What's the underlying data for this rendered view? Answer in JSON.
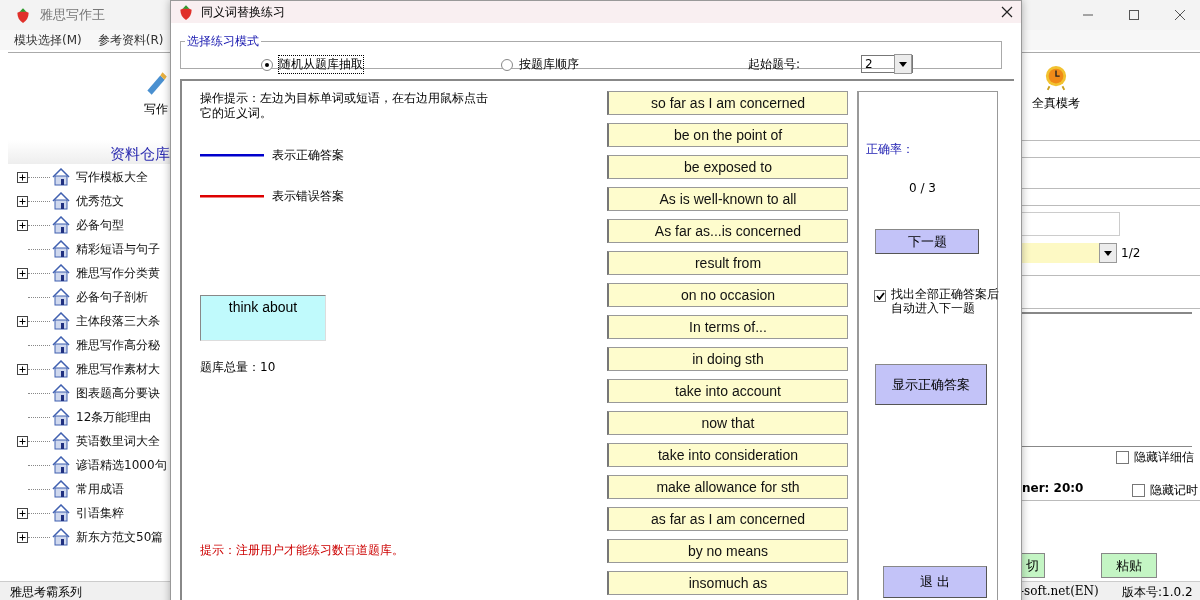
{
  "main_window": {
    "title": "雅思写作王",
    "menu": [
      "模块选择(M)",
      "参考资料(R)"
    ],
    "toolbar": [
      "写作",
      "全真模考"
    ],
    "library": {
      "title": "资料仓库",
      "items": [
        {
          "label": "写作模板大全",
          "expandable": true
        },
        {
          "label": "优秀范文",
          "expandable": true
        },
        {
          "label": "必备句型",
          "expandable": true
        },
        {
          "label": "精彩短语与句子",
          "expandable": false
        },
        {
          "label": "雅思写作分类黄",
          "expandable": true
        },
        {
          "label": "必备句子剖析",
          "expandable": false
        },
        {
          "label": "主体段落三大杀",
          "expandable": true
        },
        {
          "label": "雅思写作高分秘",
          "expandable": false
        },
        {
          "label": "雅思写作素材大",
          "expandable": true
        },
        {
          "label": "图表题高分要诀",
          "expandable": false
        },
        {
          "label": "12条万能理由",
          "expandable": false
        },
        {
          "label": "英语数里词大全",
          "expandable": true
        },
        {
          "label": "谚语精选1000句",
          "expandable": false
        },
        {
          "label": "常用成语",
          "expandable": false
        },
        {
          "label": "引语集粹",
          "expandable": true
        },
        {
          "label": "新东方范文50篇",
          "expandable": true
        }
      ]
    },
    "page_indicator": "1/2",
    "options": [
      {
        "label": "隐藏详细信",
        "checked": false
      },
      {
        "label": "隐藏记时",
        "checked": false
      }
    ],
    "timer": "ner: 20:0",
    "buttons": [
      "切",
      "粘贴"
    ],
    "status_bar": [
      "雅思考霸系列",
      "-soft.net(EN)",
      "版本号:1.0.2"
    ]
  },
  "dialog": {
    "title": "同义词替换练习",
    "mode_group": {
      "title": "选择练习模式",
      "options": [
        {
          "label": "随机从题库抽取",
          "selected": true
        },
        {
          "label": "按题库顺序",
          "selected": false
        }
      ],
      "start_label": "起始题号:",
      "start_value": "2"
    },
    "instructions": "操作提示：左边为目标单词或短语，在右边用鼠标点击它的近义词。",
    "legend": [
      {
        "label": "表示正确答案",
        "color": "#0000cc"
      },
      {
        "label": "表示错误答案",
        "color": "#dd0000"
      }
    ],
    "target": "think about",
    "bank_total": "题库总量：10",
    "notice": "提示：注册用户才能练习数百道题库。",
    "choices": [
      "so far as I am concerned",
      "be on the point of",
      "be exposed to",
      "As is well-known to all",
      "As far as...is concerned",
      "result from",
      "on no occasion",
      "In terms of...",
      "in doing sth",
      "take into account",
      "now that",
      "take into consideration",
      "make allowance for sth",
      "as far as I am concerned",
      "by no means",
      "insomuch as"
    ],
    "accuracy_label": "正确率：",
    "score": "0 / 3",
    "next_button": "下一题",
    "auto_next": {
      "label": "找出全部正确答案后自动进入下一题",
      "checked": true
    },
    "show_answer_button": "显示正确答案",
    "exit_button": "退 出"
  }
}
